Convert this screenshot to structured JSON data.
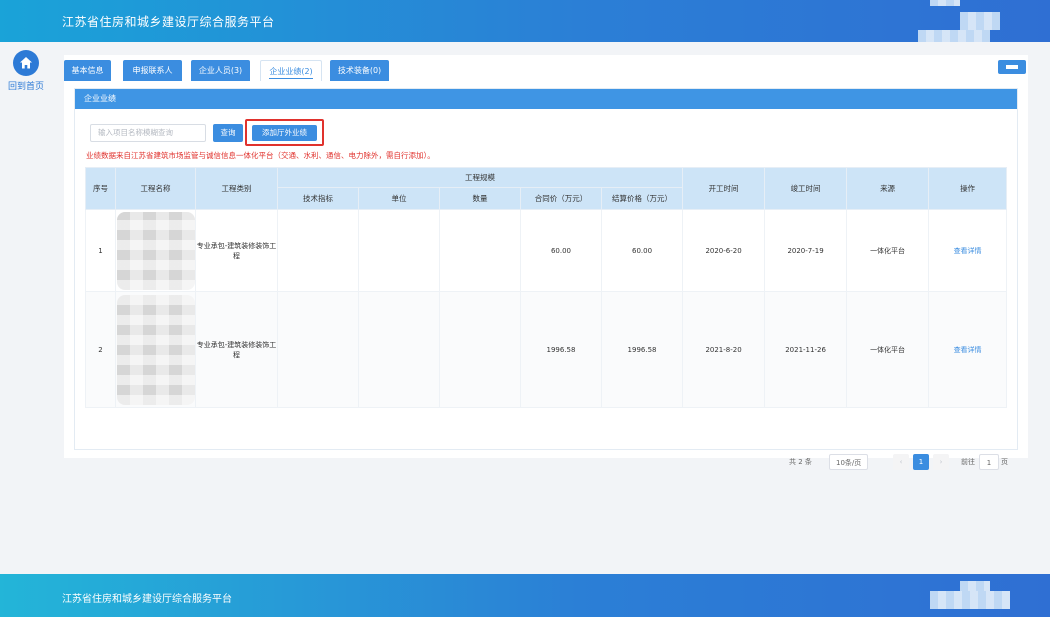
{
  "header": {
    "title": "江苏省住房和城乡建设厅综合服务平台"
  },
  "sidebar": {
    "home_label": "回到首页"
  },
  "tabs": [
    {
      "label": "基本信息"
    },
    {
      "label": "申报联系人"
    },
    {
      "label": "企业人员(3)"
    },
    {
      "label": "企业业绩(2)"
    },
    {
      "label": "技术装备(0)"
    }
  ],
  "active_tab": "企业业绩(2)",
  "section": {
    "title": "企业业绩"
  },
  "search": {
    "placeholder": "输入项目名称模糊查询",
    "query_label": "查询",
    "add_label": "添加厅外业绩"
  },
  "notice": "业绩数据来自江苏省建筑市场监管与诚信信息一体化平台（交通、水利、通信、电力除外，需自行添加）。",
  "table": {
    "headers": {
      "index": "序号",
      "name": "工程名称",
      "category": "工程类别",
      "scale_group": "工程规模",
      "tech_index": "技术指标",
      "unit": "单位",
      "quantity": "数量",
      "contract_price": "合同价（万元）",
      "settle_price": "结算价格（万元）",
      "start_date": "开工时间",
      "end_date": "竣工时间",
      "source": "来源",
      "action": "操作"
    },
    "rows": [
      {
        "index": "1",
        "category": "专业承包-建筑装修装饰工程",
        "tech_index": "",
        "unit": "",
        "quantity": "",
        "contract_price": "60.00",
        "settle_price": "60.00",
        "start_date": "2020-6-20",
        "end_date": "2020-7-19",
        "source": "一体化平台",
        "action": "查看详情"
      },
      {
        "index": "2",
        "category": "专业承包-建筑装修装饰工程",
        "tech_index": "",
        "unit": "",
        "quantity": "",
        "contract_price": "1996.58",
        "settle_price": "1996.58",
        "start_date": "2021-8-20",
        "end_date": "2021-11-26",
        "source": "一体化平台",
        "action": "查看详情"
      }
    ]
  },
  "pagination": {
    "total": "共 2 条",
    "page_size": "10条/页",
    "current_page": "1",
    "goto_label": "前往",
    "goto_value": "1",
    "page_unit": "页",
    "prev_icon": "‹",
    "next_icon": "›"
  },
  "footer": {
    "title": "江苏省住房和城乡建设厅综合服务平台"
  },
  "colors": {
    "brand": "#2d7ad6",
    "tab_active": "#3b8de0",
    "highlight": "#e0322d"
  }
}
